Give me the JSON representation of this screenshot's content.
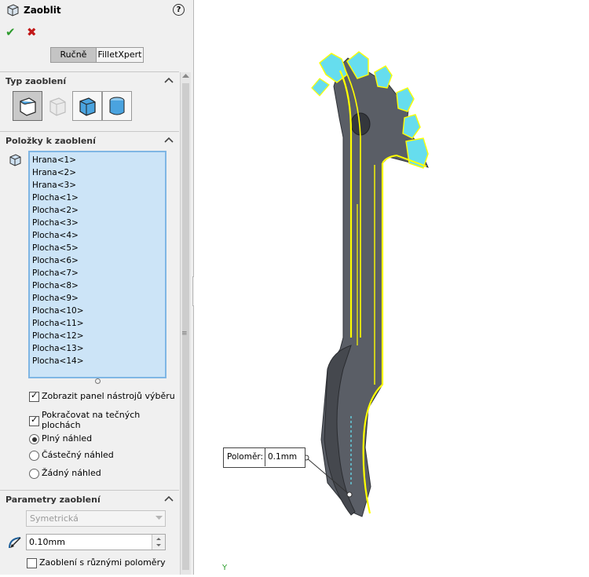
{
  "header": {
    "title": "Zaoblit",
    "help": "?",
    "ok": "✔",
    "cancel": "✖"
  },
  "tabs": [
    {
      "label": "Ručně"
    },
    {
      "label": "FilletXpert"
    }
  ],
  "section_type": {
    "title": "Typ zaoblení"
  },
  "section_items": {
    "title": "Položky k zaoblení",
    "list": [
      "Hrana<1>",
      "Hrana<2>",
      "Hrana<3>",
      "Plocha<1>",
      "Plocha<2>",
      "Plocha<3>",
      "Plocha<4>",
      "Plocha<5>",
      "Plocha<6>",
      "Plocha<7>",
      "Plocha<8>",
      "Plocha<9>",
      "Plocha<10>",
      "Plocha<11>",
      "Plocha<12>",
      "Plocha<13>",
      "Plocha<14>"
    ]
  },
  "options": {
    "show_toolbar": "Zobrazit panel nástrojů výběru",
    "tangent_line1": "Pokračovat na tečných",
    "tangent_line2": "plochách",
    "full_preview": "Plný náhled",
    "partial_preview": "Částečný náhled",
    "no_preview": "Žádný náhled"
  },
  "section_params": {
    "title": "Parametry zaoblení",
    "method": "Symetrická",
    "radius_value": "0.10mm",
    "multi_radius": "Zaoblení s různými poloměry"
  },
  "viewport": {
    "radius_label": "Poloměr:",
    "radius_value": "0.1mm",
    "axis_label": "Y"
  },
  "colors": {
    "edge_highlight": "#ffff00",
    "face_highlight": "#66ddee",
    "part_body": "#5a5e66",
    "selection_list": "#cce4f7"
  }
}
